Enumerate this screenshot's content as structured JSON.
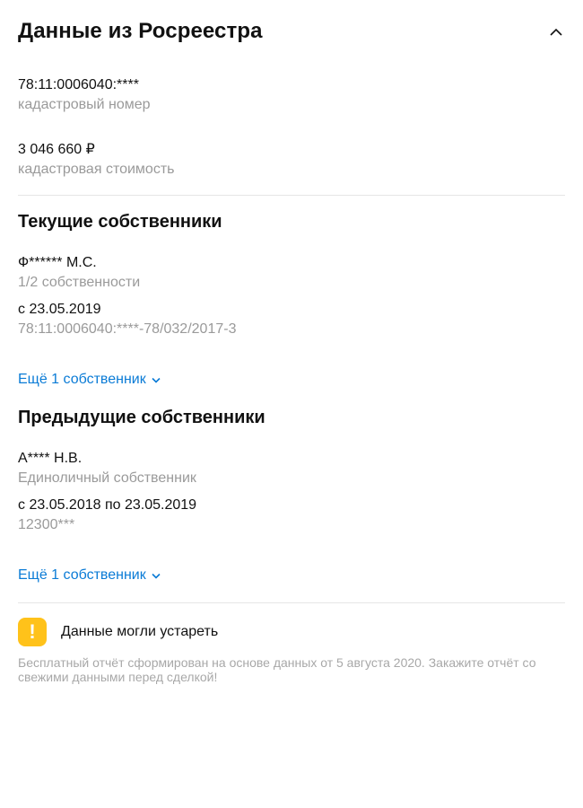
{
  "header": {
    "title": "Данные из Росреестра",
    "collapse_icon": "chevron-up-icon"
  },
  "cadastral": {
    "value": "78:11:0006040:****",
    "label": "кадастровый номер"
  },
  "cost": {
    "value": "3 046 660 ₽",
    "label": "кадастровая стоимость"
  },
  "current_owners": {
    "title": "Текущие собственники",
    "owner": {
      "name": "Ф****** М.С.",
      "share": "1/2 собственности",
      "since": "с 23.05.2019",
      "record": "78:11:0006040:****-78/032/2017-3"
    },
    "more_label": "Ещё 1 собственник"
  },
  "previous_owners": {
    "title": "Предыдущие собственники",
    "owner": {
      "name": "А**** Н.В.",
      "share": "Единоличный собственник",
      "period": "с 23.05.2018 по 23.05.2019",
      "record": "12300***"
    },
    "more_label": "Ещё 1 собственник"
  },
  "warning": {
    "icon": "exclamation-icon",
    "color": "#ffc21a",
    "title": "Данные могли устареть",
    "note": "Бесплатный отчёт сформирован на основе данных от 5 августа 2020. Закажите отчёт со свежими данными перед сделкой!"
  },
  "colors": {
    "link": "#0a7bd6",
    "muted": "#9a9a9a",
    "divider": "#e6e6e6"
  }
}
